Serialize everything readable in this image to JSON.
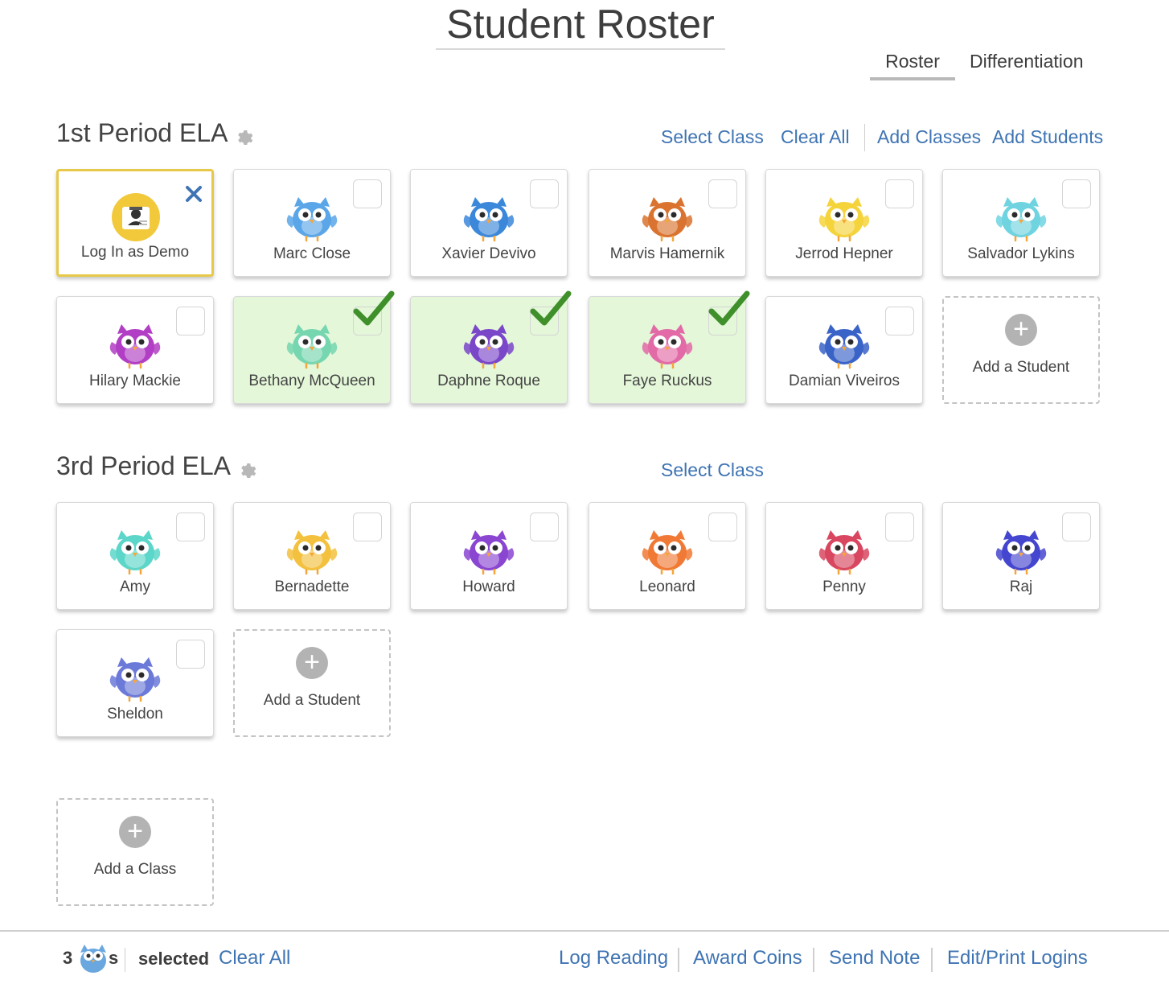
{
  "page": {
    "title": "Student Roster"
  },
  "tabs": [
    {
      "label": "Roster",
      "active": true
    },
    {
      "label": "Differentiation",
      "active": false
    }
  ],
  "classes": [
    {
      "title": "1st Period ELA",
      "actions": {
        "select_class": "Select Class",
        "clear_all": "Clear All",
        "add_classes": "Add Classes",
        "add_students": "Add Students"
      },
      "demo_card": {
        "label": "Log In as Demo"
      },
      "students": [
        {
          "name": "Marc Close",
          "selected": false,
          "color": "#5aa6e8"
        },
        {
          "name": "Xavier Devivo",
          "selected": false,
          "color": "#3b87d9"
        },
        {
          "name": "Marvis Hamernik",
          "selected": false,
          "color": "#d9732f"
        },
        {
          "name": "Jerrod Hepner",
          "selected": false,
          "color": "#f5d33b"
        },
        {
          "name": "Salvador Lykins",
          "selected": false,
          "color": "#6fd3e0"
        },
        {
          "name": "Hilary Mackie",
          "selected": false,
          "color": "#b13ec4"
        },
        {
          "name": "Bethany McQueen",
          "selected": true,
          "color": "#76d6b0"
        },
        {
          "name": "Daphne Roque",
          "selected": true,
          "color": "#7a47c9"
        },
        {
          "name": "Faye Ruckus",
          "selected": true,
          "color": "#e26aa6"
        },
        {
          "name": "Damian Viveiros",
          "selected": false,
          "color": "#3a63c8"
        }
      ],
      "add_student_label": "Add a Student"
    },
    {
      "title": "3rd Period ELA",
      "actions": {
        "select_class": "Select Class"
      },
      "students": [
        {
          "name": "Amy",
          "selected": false,
          "color": "#5cd6c9"
        },
        {
          "name": "Bernadette",
          "selected": false,
          "color": "#f3c13e"
        },
        {
          "name": "Howard",
          "selected": false,
          "color": "#8a45d1"
        },
        {
          "name": "Leonard",
          "selected": false,
          "color": "#f07a35"
        },
        {
          "name": "Penny",
          "selected": false,
          "color": "#d84660"
        },
        {
          "name": "Raj",
          "selected": false,
          "color": "#4546cf"
        },
        {
          "name": "Sheldon",
          "selected": false,
          "color": "#6b7ad8"
        }
      ],
      "add_student_label": "Add a Student"
    }
  ],
  "add_class_label": "Add a Class",
  "footer": {
    "count": "3",
    "owl_suffix": "s",
    "selected_label": "selected",
    "clear_all": "Clear All",
    "actions": [
      "Log Reading",
      "Award Coins",
      "Send Note",
      "Edit/Print Logins"
    ]
  }
}
